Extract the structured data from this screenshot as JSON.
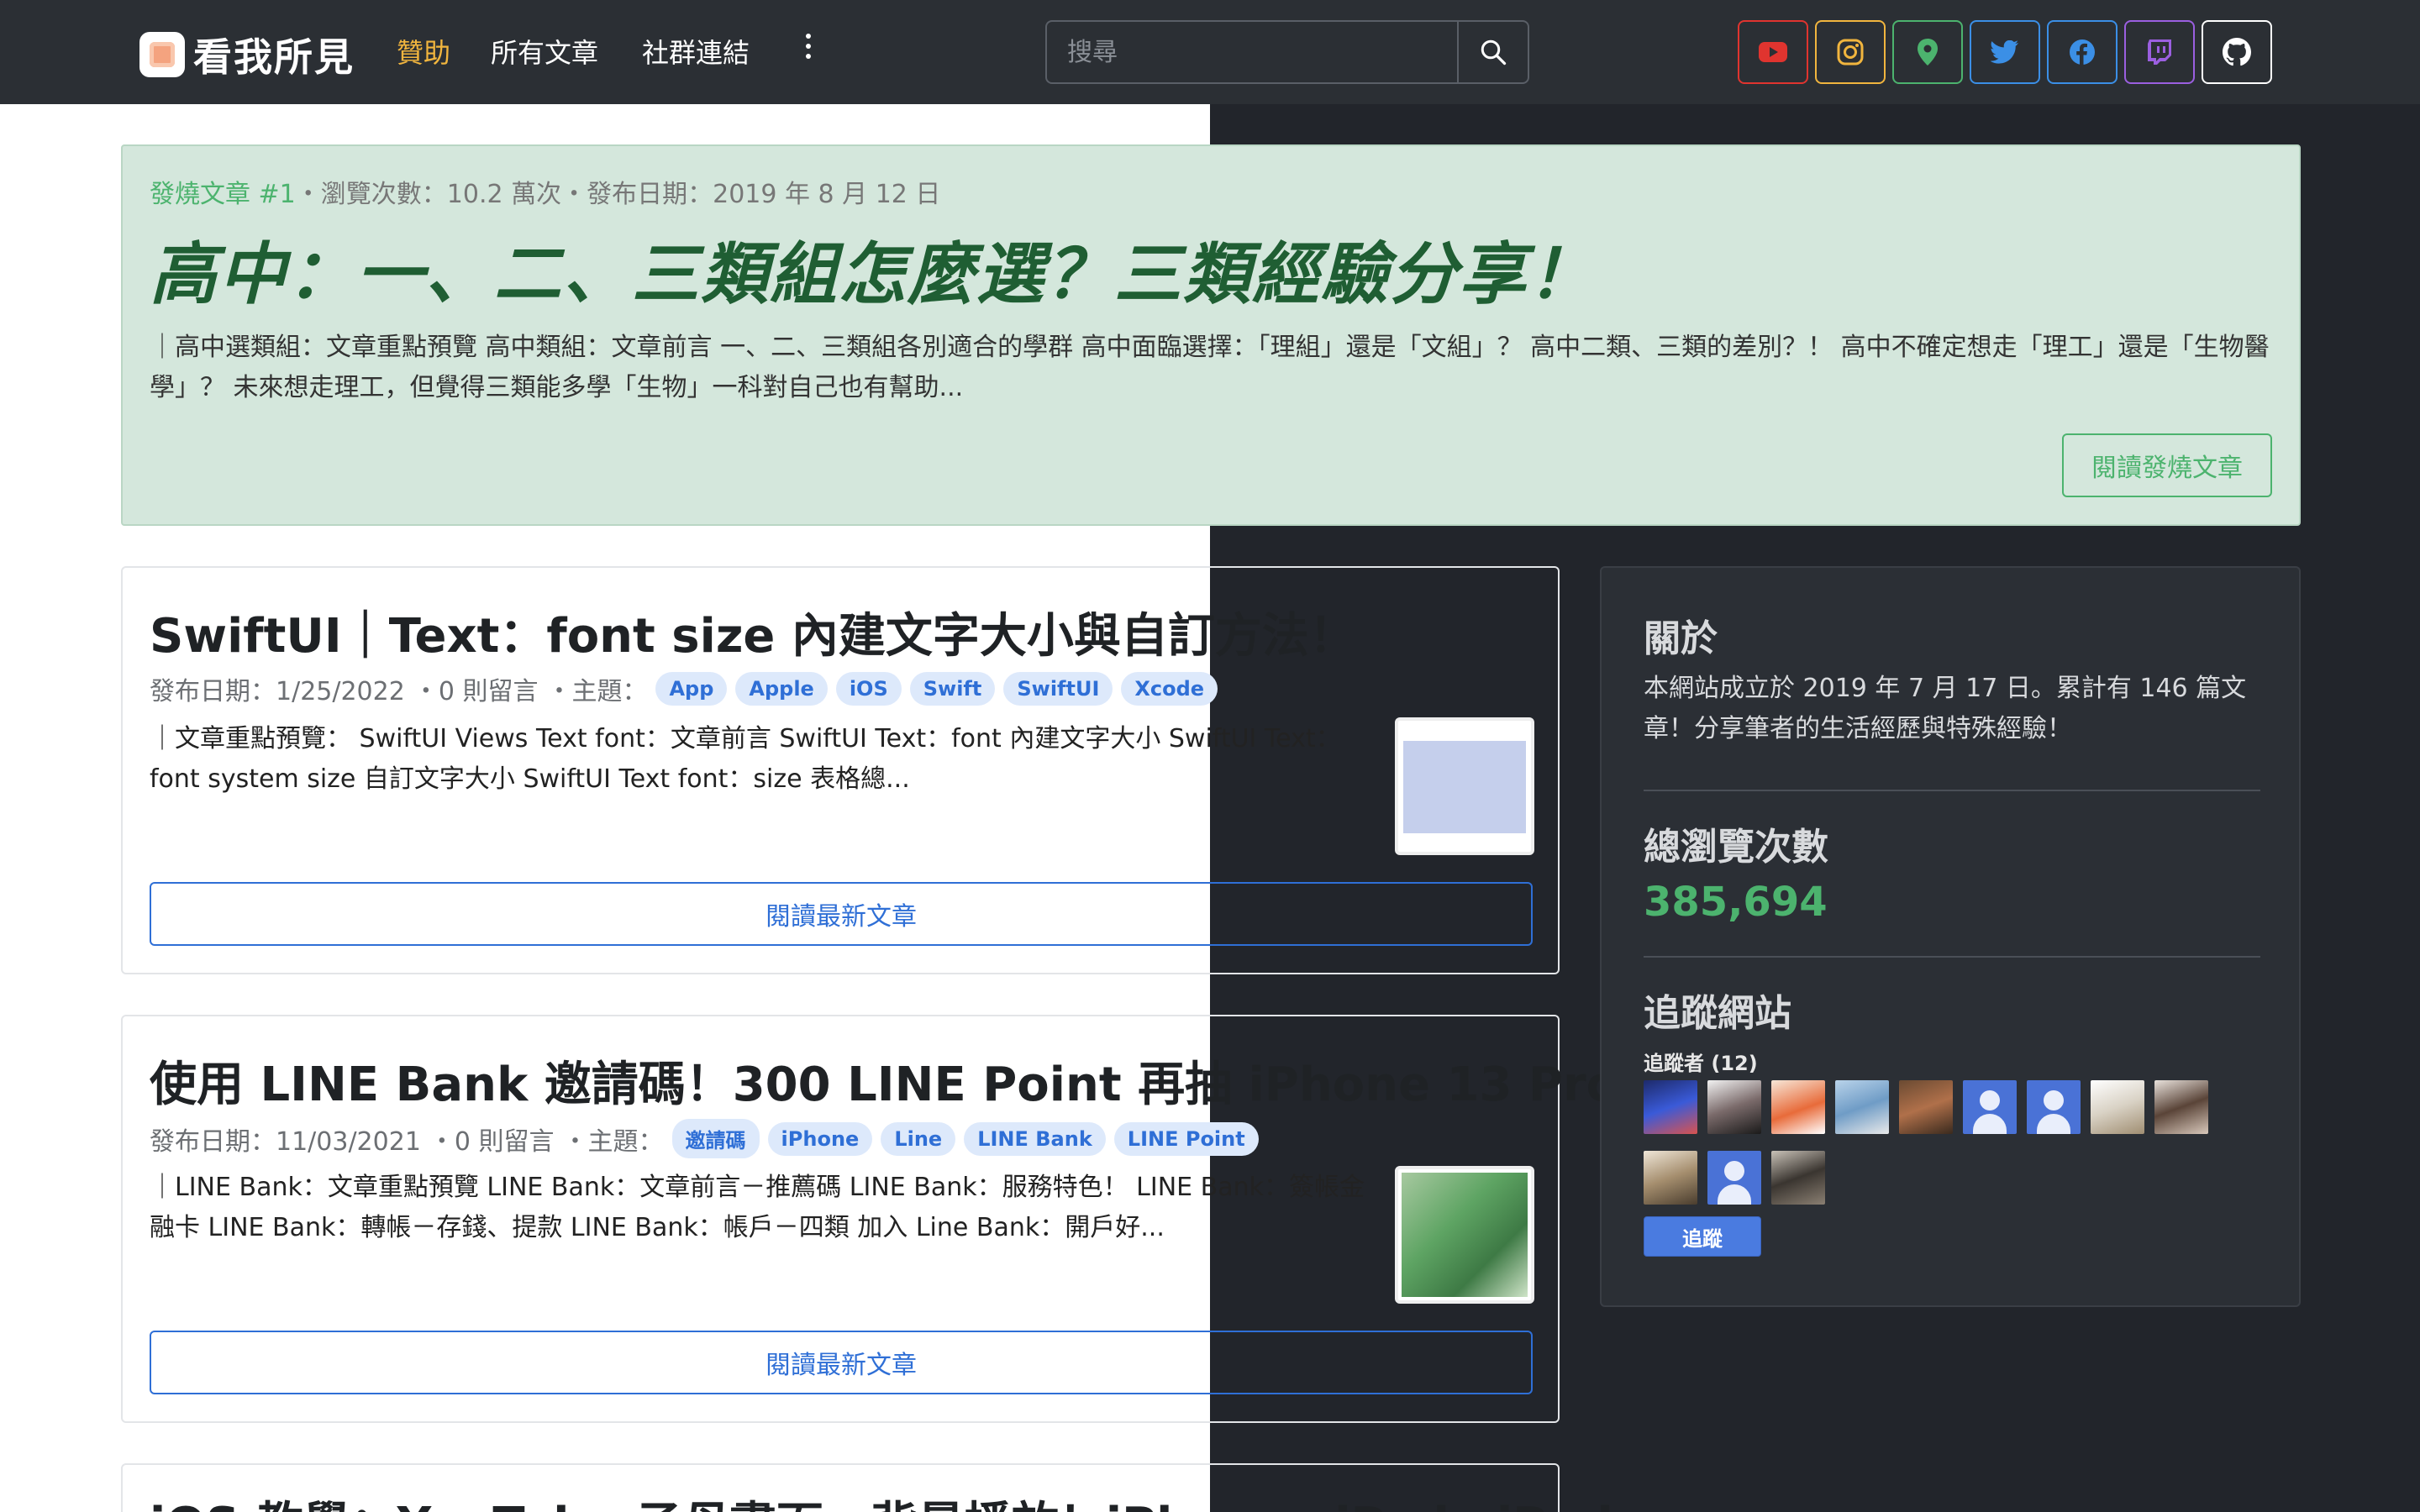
{
  "navbar": {
    "brand": "看我所見",
    "links": [
      {
        "label": "贊助",
        "active": true
      },
      {
        "label": "所有文章",
        "active": false
      },
      {
        "label": "社群連結",
        "active": false
      }
    ],
    "more_icon": "kebab-vertical-icon",
    "search_placeholder": "搜尋",
    "search_icon": "search-icon",
    "socials": [
      {
        "name": "youtube-icon",
        "color": "#e0342f"
      },
      {
        "name": "instagram-icon",
        "color": "#f1b53e"
      },
      {
        "name": "map-pin-icon",
        "color": "#4cb36e"
      },
      {
        "name": "twitter-icon",
        "color": "#3b8fe6"
      },
      {
        "name": "facebook-icon",
        "color": "#3b8fe6"
      },
      {
        "name": "twitch-icon",
        "color": "#9b5fe0"
      },
      {
        "name": "github-icon",
        "color": "#ffffff"
      }
    ]
  },
  "hero": {
    "hot_label": "發燒文章 #1",
    "views": "・瀏覽次數：10.2 萬次",
    "date": "・發布日期：2019 年 8 月 12 日",
    "title": "高中：一、二、三類組怎麼選？三類經驗分享！",
    "excerpt": "｜高中選類組：文章重點預覽 高中類組：文章前言 一、二、三類組各別適合的學群 高中面臨選擇：「理組」還是「文組」？ 高中二類、三類的差別？！ 高中不確定想走「理工」還是「生物醫學」？ 未來想走理工，但覺得三類能多學「生物」一科對自己也有幫助...",
    "button": "閱讀發燒文章"
  },
  "posts": [
    {
      "title": "SwiftUI｜Text：font size 內建文字大小與自訂方法！",
      "date": "發布日期：1/25/2022",
      "comments": "・0 則留言",
      "topic_label": "・主題：",
      "tags": [
        "App",
        "Apple",
        "iOS",
        "Swift",
        "SwiftUI",
        "Xcode"
      ],
      "excerpt": "｜文章重點預覽： SwiftUI Views Text font：文章前言 SwiftUI Text：font 內建文字大小 SwiftUI Text：font system size 自訂文字大小 SwiftUI Text font：size 表格總...",
      "button": "閱讀最新文章"
    },
    {
      "title": "使用 LINE Bank 邀請碼！300 LINE Point 再抽 iPhone 13 Pro！",
      "date": "發布日期：11/03/2021",
      "comments": "・0 則留言",
      "topic_label": "・主題：",
      "tags": [
        "邀請碼",
        "iPhone",
        "Line",
        "LINE Bank",
        "LINE Point"
      ],
      "excerpt": "｜LINE Bank：文章重點預覽 LINE Bank：文章前言－推薦碼 LINE Bank：服務特色！ LINE Bank：簽帳金融卡 LINE Bank：轉帳－存錢、提款 LINE Bank：帳戶－四類 加入 Line Bank：開戶好...",
      "button": "閱讀最新文章"
    },
    {
      "title": "iOS 教學：YouTube 子母畫面、背景播放！iPhone、iPad、iPod"
    }
  ],
  "sidebar": {
    "about_heading": "關於",
    "about_text": "本網站成立於 2019 年 7 月 17 日。累計有 146 篇文章！分享筆者的生活經歷與特殊經驗！",
    "views_heading": "總瀏覽次數",
    "views_value": "385,694",
    "follow_heading": "追蹤網站",
    "followers_label": "追蹤者 (12)",
    "follow_button": "追蹤"
  }
}
